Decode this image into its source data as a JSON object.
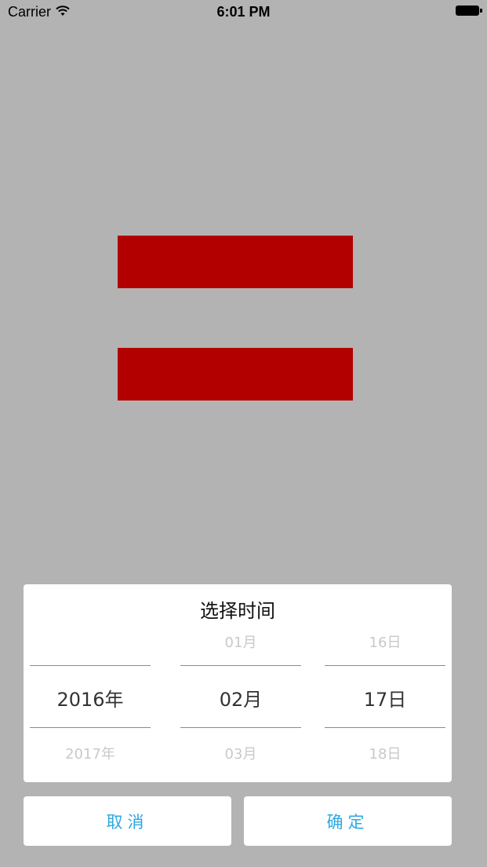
{
  "status_bar": {
    "carrier": "Carrier",
    "time": "6:01 PM"
  },
  "picker": {
    "title": "选择时间",
    "columns": [
      {
        "prev": "",
        "current": "2016年",
        "next": "2017年"
      },
      {
        "prev": "01月",
        "current": "02月",
        "next": "03月"
      },
      {
        "prev": "16日",
        "current": "17日",
        "next": "18日"
      }
    ]
  },
  "buttons": {
    "cancel": "取消",
    "confirm": "确定"
  },
  "colors": {
    "background": "#b3b3b3",
    "block": "#b20000",
    "accent": "#2ca8e0",
    "selection_line": "#3aa6d6"
  },
  "icons": {
    "wifi": "wifi-icon",
    "battery": "battery-icon"
  }
}
